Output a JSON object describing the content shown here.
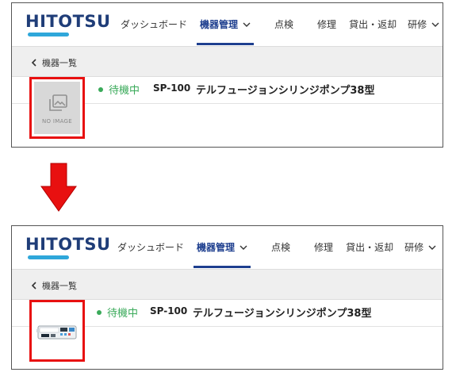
{
  "before": {
    "logo": "HITOTSU",
    "nav": [
      {
        "label": "ダッシュボード"
      },
      {
        "label": "機器管理",
        "active": true,
        "dropdown": true
      },
      {
        "label": "点検"
      },
      {
        "label": "修理"
      },
      {
        "label": "貸出・返却"
      },
      {
        "label": "研修",
        "dropdown": true
      }
    ],
    "back_label": "機器一覧",
    "status": "待機中",
    "code": "SP-100",
    "name": "テルフュージョンシリンジポンプ38型",
    "no_image_label": "NO IMAGE"
  },
  "after": {
    "logo": "HITOTSU",
    "nav": [
      {
        "label": "ダッシュボード"
      },
      {
        "label": "機器管理",
        "active": true,
        "dropdown": true
      },
      {
        "label": "点検"
      },
      {
        "label": "修理"
      },
      {
        "label": "貸出・返却"
      },
      {
        "label": "研修",
        "dropdown": true
      }
    ],
    "back_label": "機器一覧",
    "status": "待機中",
    "code": "SP-100",
    "name": "テルフュージョンシリンジポンプ38型"
  },
  "colors": {
    "brand": "#1f3d78",
    "accent_bar": "#2fa7da",
    "active_nav": "#1e3f8f",
    "status_green": "#3aaa5a",
    "highlight_red": "#e81010"
  },
  "icons": {
    "before_thumbnail": "image-placeholder-icon",
    "after_thumbnail": "syringe-pump-device-image",
    "transition": "down-arrow-icon"
  }
}
